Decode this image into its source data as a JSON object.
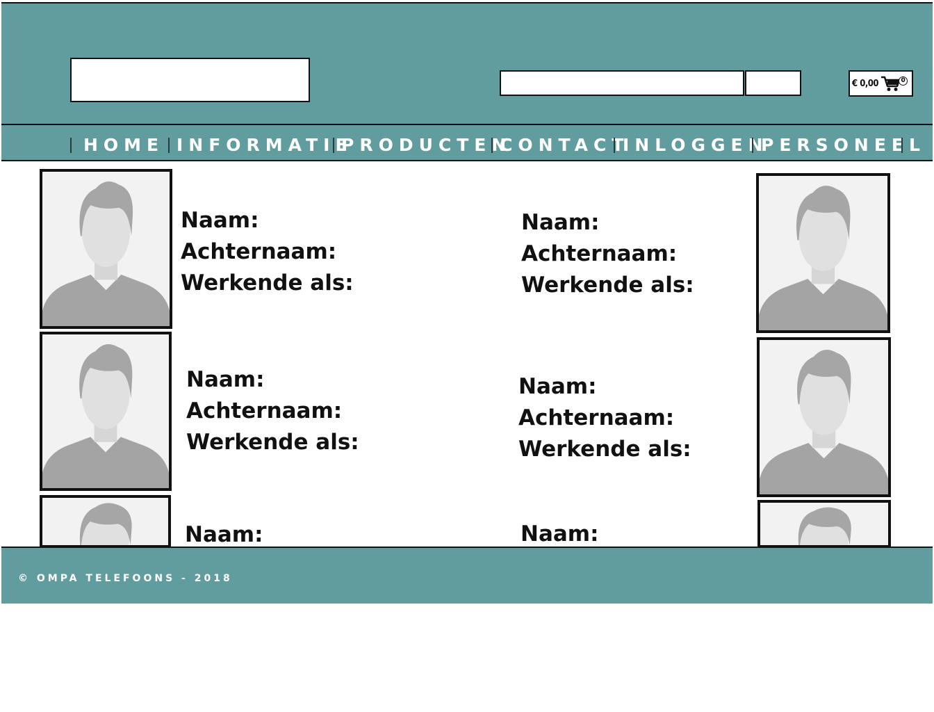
{
  "header": {
    "cart": {
      "price": "€ 0,00",
      "count": "0"
    }
  },
  "nav": {
    "items": [
      {
        "label": "HOME"
      },
      {
        "label": "INFORMATIE"
      },
      {
        "label": "PRODUCTEN"
      },
      {
        "label": "CONTACT"
      },
      {
        "label": "INLOGGEN"
      },
      {
        "label": "PERSONEEL"
      }
    ]
  },
  "staff": {
    "name_label": "Naam:",
    "lastname_label": "Achternaam:",
    "role_label": "Werkende als:"
  },
  "footer": {
    "copyright": "© OMPA TELEFOONS - 2018"
  },
  "colors": {
    "brand": "#619d9e",
    "border": "#111111",
    "placeholder_bg": "#f2f2f2"
  },
  "icons": {
    "cart": "shopping-cart-icon",
    "avatar": "avatar-placeholder-icon"
  }
}
